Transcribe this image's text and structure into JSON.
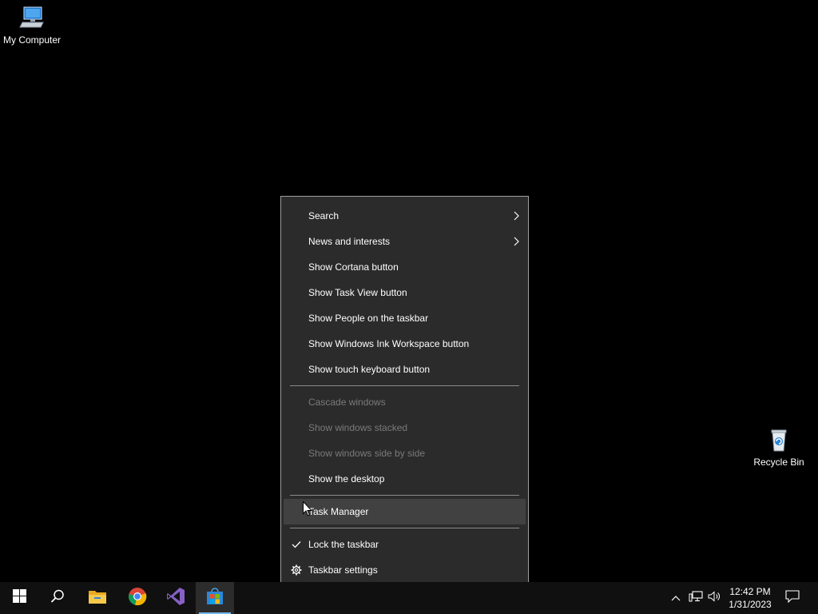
{
  "desktop": {
    "icons": [
      {
        "label": "My Computer",
        "icon": "computer-icon"
      },
      {
        "label": "Recycle Bin",
        "icon": "recycle-bin-icon"
      }
    ]
  },
  "context_menu": {
    "items": [
      {
        "label": "Search",
        "submenu": true,
        "enabled": true
      },
      {
        "label": "News and interests",
        "submenu": true,
        "enabled": true
      },
      {
        "label": "Show Cortana button",
        "enabled": true
      },
      {
        "label": "Show Task View button",
        "enabled": true
      },
      {
        "label": "Show People on the taskbar",
        "enabled": true
      },
      {
        "label": "Show Windows Ink Workspace button",
        "enabled": true
      },
      {
        "label": "Show touch keyboard button",
        "enabled": true
      },
      {
        "label": "Cascade windows",
        "enabled": false
      },
      {
        "label": "Show windows stacked",
        "enabled": false
      },
      {
        "label": "Show windows side by side",
        "enabled": false
      },
      {
        "label": "Show the desktop",
        "enabled": true
      },
      {
        "label": "Task Manager",
        "enabled": true,
        "hovered": true
      },
      {
        "label": "Lock the taskbar",
        "enabled": true,
        "checked": true
      },
      {
        "label": "Taskbar settings",
        "enabled": true,
        "icon": "gear-icon"
      }
    ]
  },
  "taskbar": {
    "buttons": [
      {
        "icon": "windows-start-icon"
      },
      {
        "icon": "search-icon"
      },
      {
        "icon": "file-explorer-icon"
      },
      {
        "icon": "chrome-icon"
      },
      {
        "icon": "visual-studio-icon"
      },
      {
        "icon": "microsoft-store-icon",
        "active": true
      }
    ],
    "tray": [
      {
        "icon": "chevron-up-icon"
      },
      {
        "icon": "network-icon"
      },
      {
        "icon": "volume-icon"
      }
    ],
    "clock": {
      "time": "12:42 PM",
      "date": "1/31/2023"
    },
    "notification_icon": "notification-icon"
  },
  "colors": {
    "menu_background": "#2b2b2b",
    "menu_hover": "#414141",
    "disabled_text": "#7a7a7a",
    "taskbar_background": "#101010",
    "accent": "#76b9ed"
  }
}
